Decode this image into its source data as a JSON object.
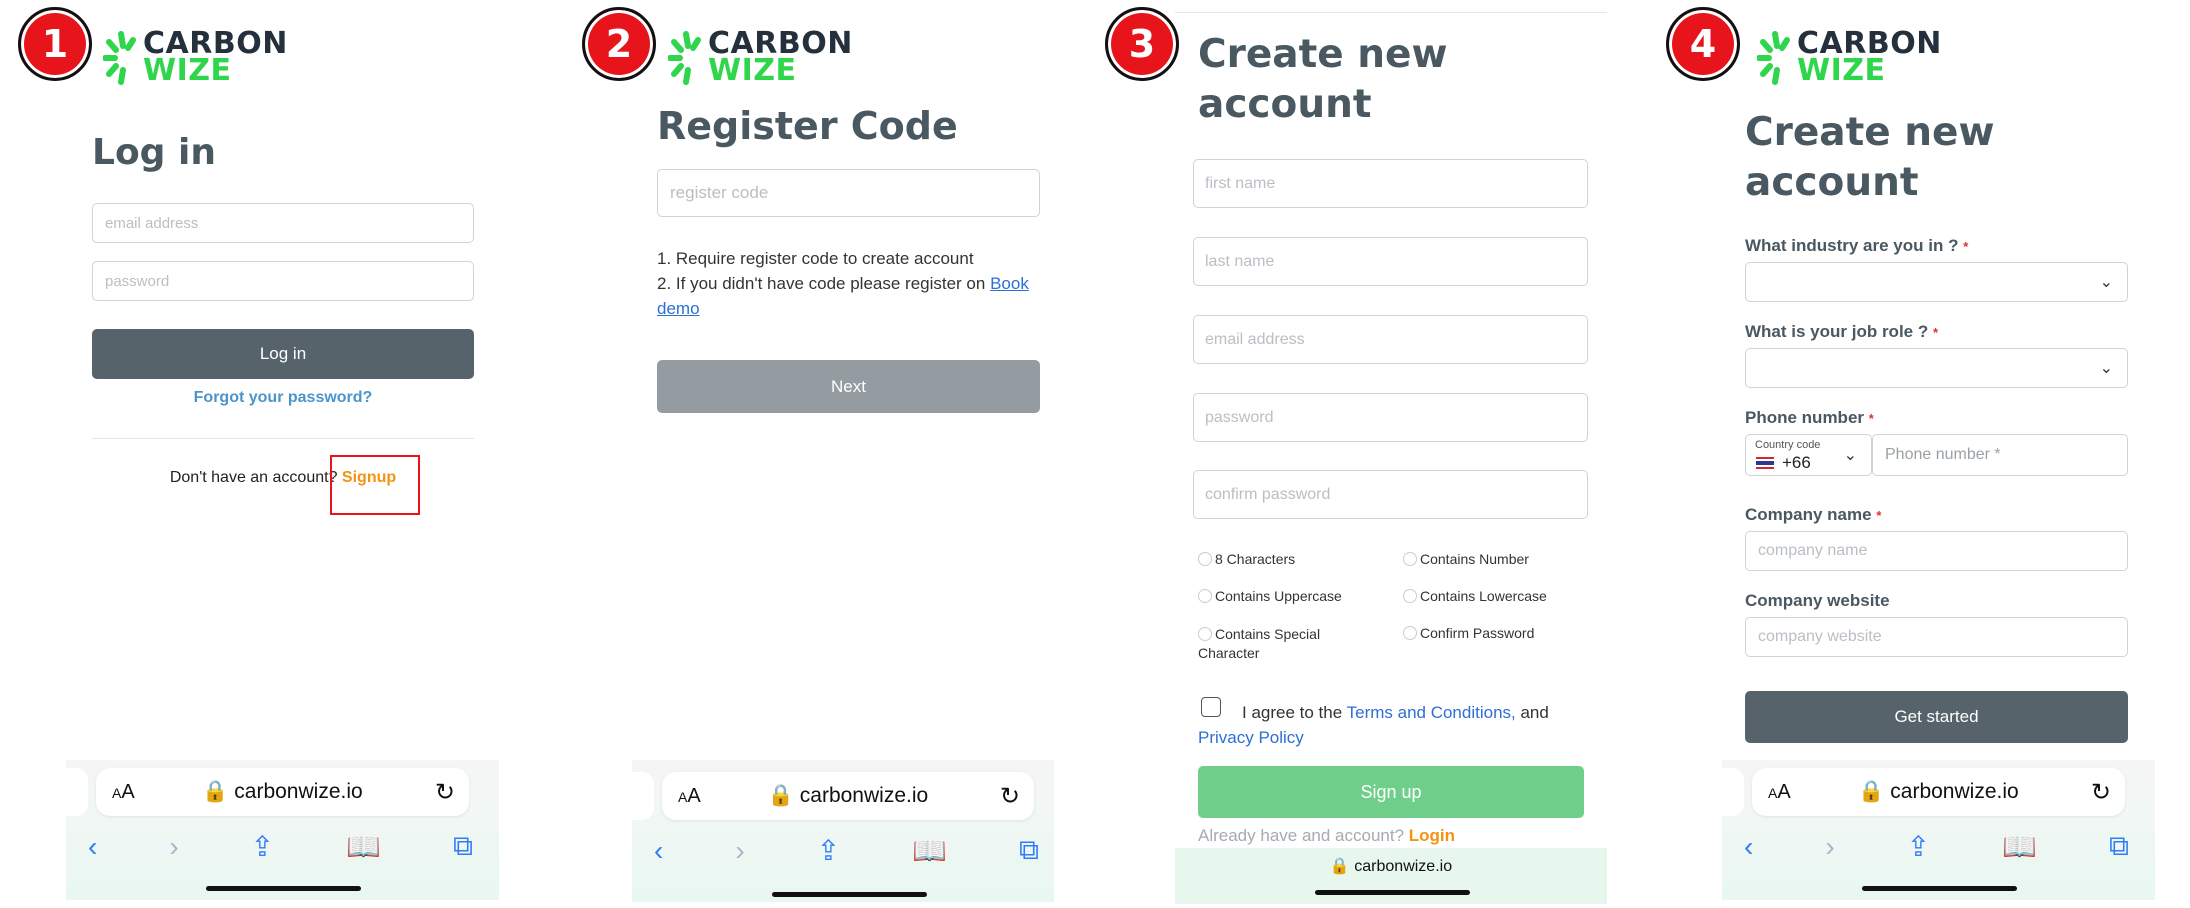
{
  "badges": [
    "1",
    "2",
    "3",
    "4"
  ],
  "logo": {
    "line1": "CARBON",
    "line2": "WIZE"
  },
  "screen1": {
    "title": "Log in",
    "email_placeholder": "email address",
    "password_placeholder": "password",
    "login_label": "Log in",
    "forgot_label": "Forgot your password?",
    "no_account_text": "Don't have an account?",
    "signup_label": "Signup"
  },
  "screen2": {
    "title": "Register Code",
    "code_placeholder": "register code",
    "note1": "1. Require register code to create account",
    "note2_prefix": "2. If you didn't have code please register on ",
    "note2_link1": "Book",
    "note2_link2": "demo",
    "next_label": "Next"
  },
  "screen3": {
    "title_line1": "Create new",
    "title_line2": "account",
    "first_name_placeholder": "first name",
    "last_name_placeholder": "last name",
    "email_placeholder": "email address",
    "password_placeholder": "password",
    "confirm_placeholder": "confirm password",
    "checks": {
      "chars8": "8 Characters",
      "number": "Contains Number",
      "upper": "Contains Uppercase",
      "lower": "Contains Lowercase",
      "special_line1": "Contains Special",
      "special_line2": "Character",
      "confirm": "Confirm Password"
    },
    "agree_prefix": "I agree to the ",
    "terms_link": "Terms and Conditions,",
    "agree_and": " and",
    "privacy_link": "Privacy Policy",
    "signup_label": "Sign up",
    "already_text": "Already have and account?",
    "login_link": "Login",
    "footer_url": "carbonwize.io"
  },
  "screen4": {
    "title_line1": "Create new",
    "title_line2": "account",
    "industry_label": "What industry are you in ?",
    "role_label": "What is your job role ?",
    "phone_label": "Phone number",
    "country_code_caption": "Country code",
    "country_code_value": "+66",
    "phone_placeholder": "Phone number *",
    "company_label": "Company name",
    "company_placeholder": "company name",
    "website_label": "Company website",
    "website_placeholder": "company website",
    "get_started_label": "Get started",
    "required_mark": "*"
  },
  "safari": {
    "text_size": "AA",
    "url": "carbonwize.io"
  },
  "colors": {
    "badge": "#e8141c",
    "logo_dark": "#24313d",
    "logo_green": "#2fd64b",
    "primary_button": "#57636b",
    "next_button": "#949ca1",
    "signup_button": "#6fcf8a",
    "accent_orange": "#f39314",
    "link_blue": "#2c6fd6"
  }
}
